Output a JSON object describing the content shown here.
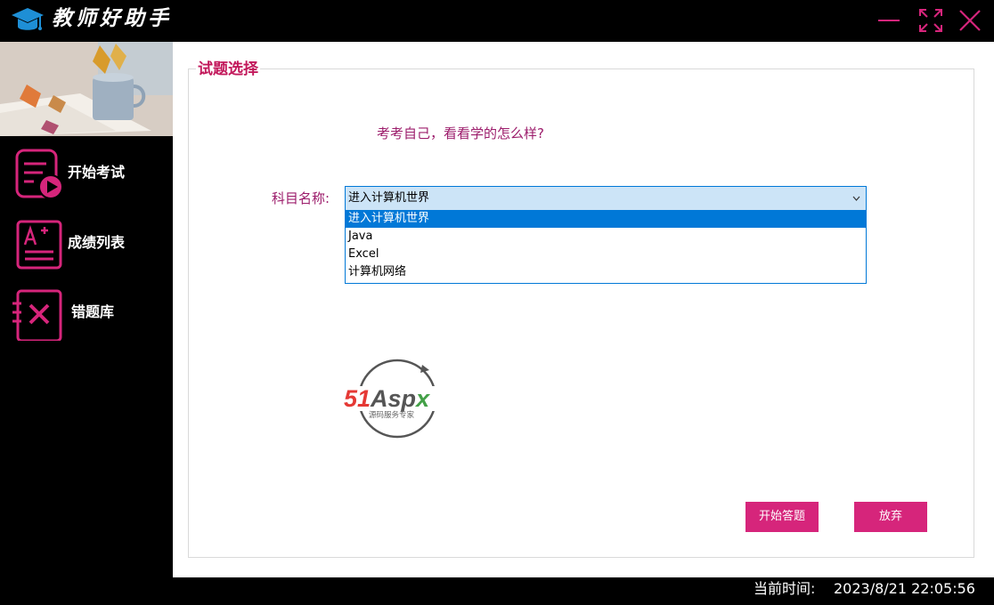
{
  "app": {
    "title": "教师好助手"
  },
  "window_controls": {
    "minimize_icon": "minimize-icon",
    "maximize_icon": "maximize-icon",
    "close_icon": "close-icon",
    "color": "#d6257b"
  },
  "sidebar": {
    "items": [
      {
        "label": "开始考试",
        "icon": "exam-start-icon"
      },
      {
        "label": "成绩列表",
        "icon": "score-list-icon"
      },
      {
        "label": "错题库",
        "icon": "wrong-questions-icon"
      }
    ],
    "accent": "#d6257b"
  },
  "main": {
    "group_title": "试题选择",
    "prompt": "考考自己，看看学的怎么样?",
    "subject_label": "科目名称:",
    "subject_select": {
      "value": "进入计算机世界",
      "options": [
        "进入计算机世界",
        "Java",
        "Excel",
        "计算机网络"
      ],
      "selected_index": 0
    },
    "logo": {
      "brand": "51Aspx",
      "tagline": "源码服务专家"
    },
    "buttons": {
      "start": "开始答题",
      "abandon": "放弃"
    }
  },
  "status": {
    "clock_label": "当前时间:",
    "clock_value": "2023/8/21 22:05:56"
  },
  "colors": {
    "accent": "#d6257b",
    "title_pink": "#c2185b",
    "text_plum": "#9c1c6b",
    "select_blue": "#0078d7",
    "select_bg": "#cce4f7"
  }
}
